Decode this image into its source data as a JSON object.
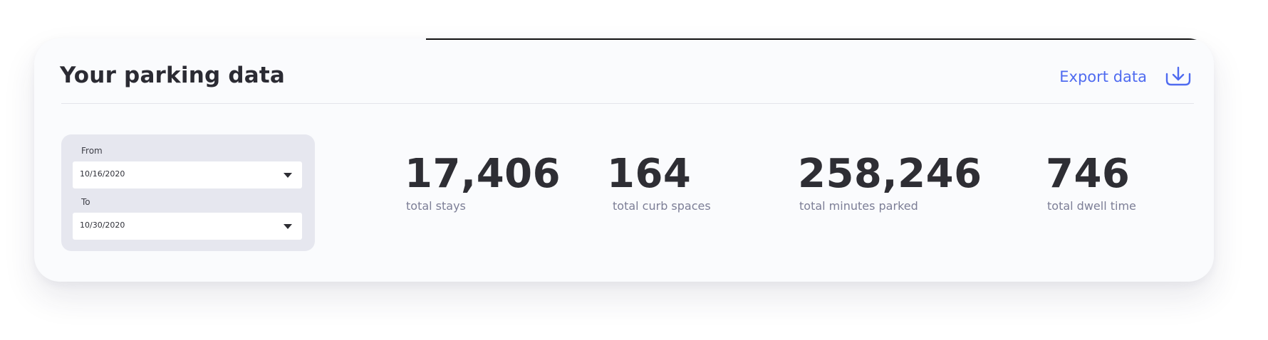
{
  "header": {
    "title": "Your parking data",
    "export_label": "Export data",
    "export_icon": "download-icon"
  },
  "date_range": {
    "from_label": "From",
    "from_value": "10/16/2020",
    "to_label": "To",
    "to_value": "10/30/2020"
  },
  "stats": [
    {
      "value": "17,406",
      "label": "total stays"
    },
    {
      "value": "164",
      "label": "total curb spaces"
    },
    {
      "value": "258,246",
      "label": "total minutes parked"
    },
    {
      "value": "746",
      "label": "total dwell time"
    }
  ],
  "colors": {
    "accent": "#4f6bf0",
    "card_background": "#fafbfd",
    "panel_background": "#e6e7ef",
    "text_primary": "#2e2e34",
    "text_secondary": "#7c7e96"
  }
}
